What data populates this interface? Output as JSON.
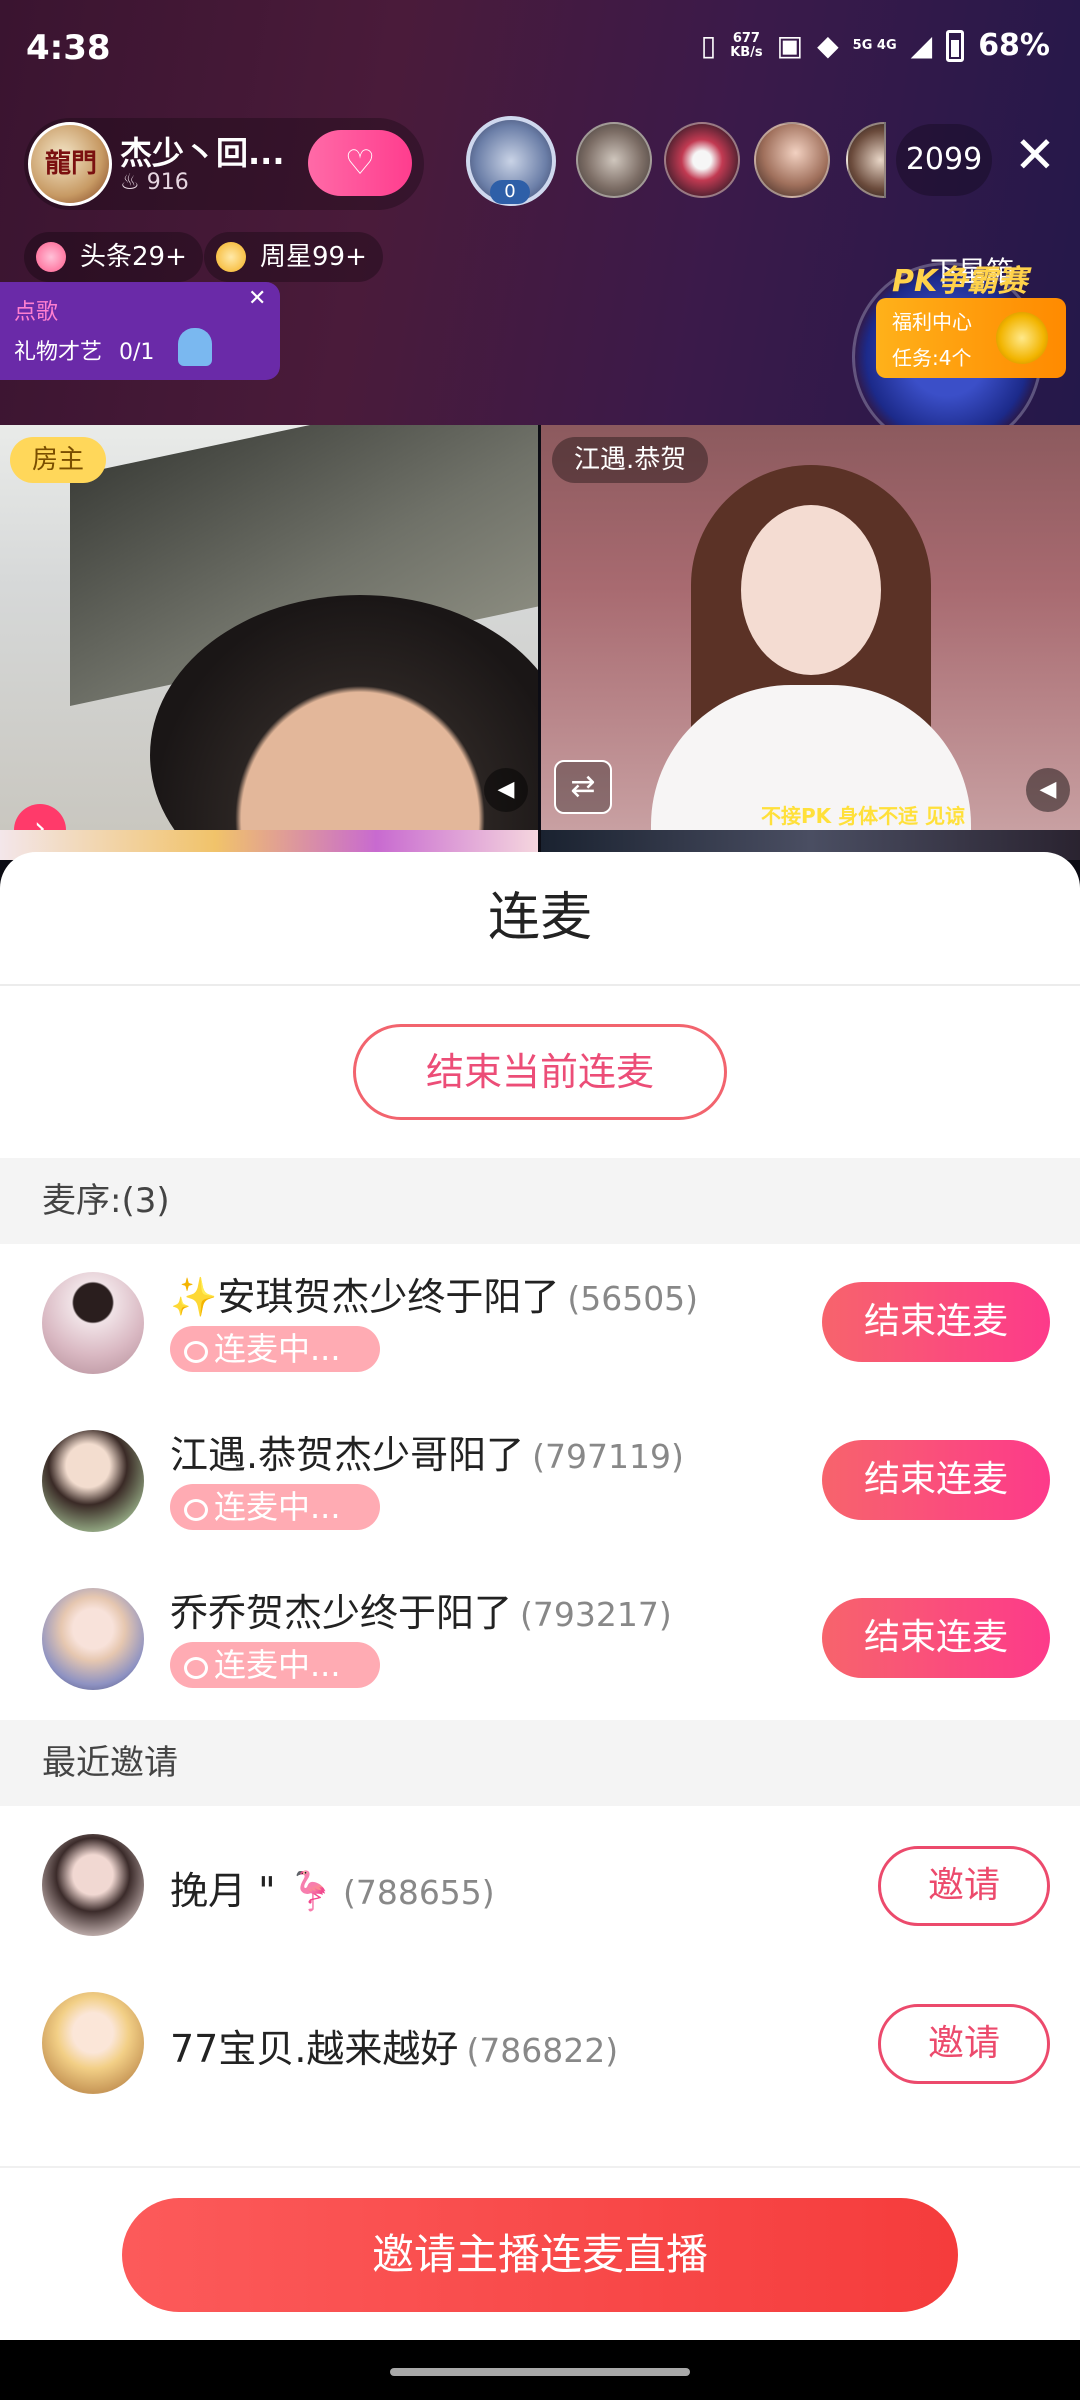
{
  "status_bar": {
    "time": "4:38",
    "net_speed_value": "677",
    "net_speed_unit": "KB/s",
    "network": "5G 4G",
    "battery": "68%"
  },
  "host": {
    "name": "杰少丶回...",
    "heat": "916",
    "avatar_text": "龍門"
  },
  "viewers": {
    "top_badge": "0",
    "count": "2099"
  },
  "tags": {
    "headline": "头条29+",
    "weekly_star": "周星99+"
  },
  "song_request": {
    "title": "点歌",
    "label": "礼物才艺",
    "count": "0/1"
  },
  "side_widgets": {
    "box_label": "下星箱",
    "pk_title": "PK争霸赛",
    "welfare_title": "福利中心",
    "welfare_tasks": "任务:4个"
  },
  "tiles": {
    "owner_tag": "房主",
    "guest_tag": "江遇.恭贺",
    "right_banner": "不接PK  身体不适 见谅"
  },
  "sheet": {
    "title": "连麦",
    "end_current_label": "结束当前连麦",
    "queue_header": "麦序:(3)",
    "recent_header": "最近邀请",
    "queue": [
      {
        "name": "✨安琪贺杰少终于阳了",
        "uid": "(56505)",
        "status": "连麦中...",
        "action": "结束连麦"
      },
      {
        "name": "江遇.恭贺杰少哥阳了",
        "uid": "(797119)",
        "status": "连麦中...",
        "action": "结束连麦"
      },
      {
        "name": "乔乔贺杰少终于阳了",
        "uid": "(793217)",
        "status": "连麦中...",
        "action": "结束连麦"
      }
    ],
    "recent": [
      {
        "name": "挽月 \" 🦩",
        "uid": "(788655)",
        "action": "邀请"
      },
      {
        "name": "77宝贝.越来越好",
        "uid": "(786822)",
        "action": "邀请"
      }
    ],
    "main_button": "邀请主播连麦直播"
  }
}
